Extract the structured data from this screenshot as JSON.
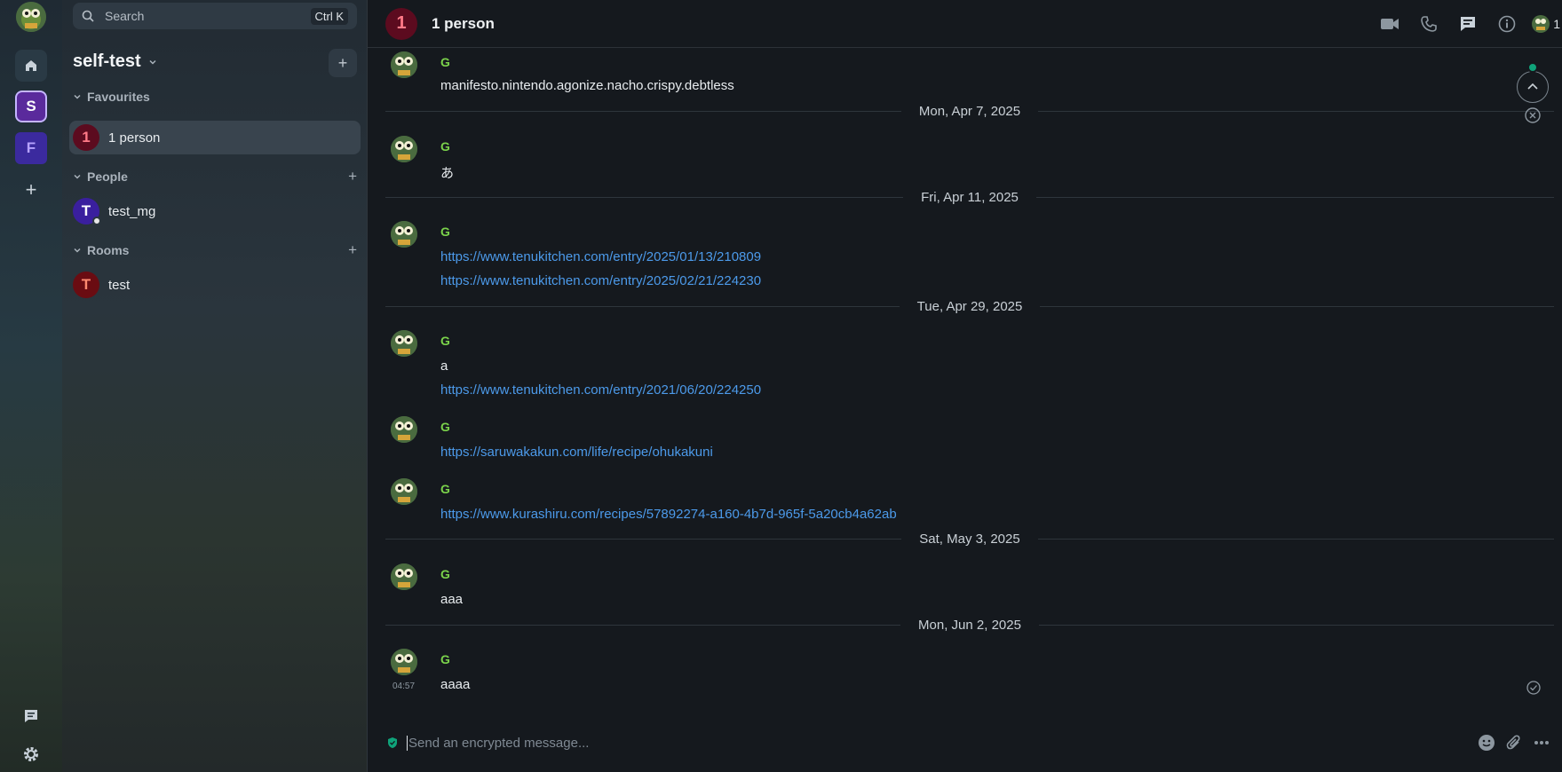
{
  "rail": {
    "spaces": [
      {
        "letter": "S",
        "name": "self-test"
      },
      {
        "letter": "F",
        "name": "F"
      }
    ],
    "add_symbol": "+"
  },
  "sidebar": {
    "search_placeholder": "Search",
    "search_shortcut": "Ctrl K",
    "space_name": "self-test",
    "add_symbol": "+",
    "sections": [
      {
        "label": "Favourites",
        "rooms": [
          {
            "initial": "1",
            "name": "1 person",
            "color": "#5c0b1f",
            "text_color": "#ff7a88",
            "active": true
          }
        ]
      },
      {
        "label": "People",
        "rooms": [
          {
            "initial": "T",
            "name": "test_mg",
            "color": "#3a1f9e",
            "text_color": "#ffffff",
            "active": false
          }
        ]
      },
      {
        "label": "Rooms",
        "rooms": [
          {
            "initial": "T",
            "name": "test",
            "color": "#6a0c12",
            "text_color": "#ff8a70",
            "active": false
          }
        ]
      }
    ]
  },
  "header": {
    "room_initial": "1",
    "room_name": "1 person",
    "member_count": "1",
    "icons": [
      "video-call-icon",
      "voice-call-icon",
      "threads-icon",
      "room-info-icon"
    ]
  },
  "timeline": {
    "first_message": {
      "sender": "G",
      "text": "manifesto.nintendo.agonize.nacho.crispy.debtless"
    },
    "groups": [
      {
        "date": "Mon, Apr 7, 2025",
        "messages": [
          {
            "sender": "G",
            "lines": [
              {
                "text": "あ",
                "link": false
              }
            ]
          }
        ]
      },
      {
        "date": "Fri, Apr 11, 2025",
        "messages": [
          {
            "sender": "G",
            "lines": [
              {
                "text": "https://www.tenukitchen.com/entry/2025/01/13/210809",
                "link": true
              },
              {
                "text": "https://www.tenukitchen.com/entry/2025/02/21/224230",
                "link": true
              }
            ]
          }
        ]
      },
      {
        "date": "Tue, Apr 29, 2025",
        "messages": [
          {
            "sender": "G",
            "lines": [
              {
                "text": "a",
                "link": false
              },
              {
                "text": "https://www.tenukitchen.com/entry/2021/06/20/224250",
                "link": true
              }
            ]
          },
          {
            "sender": "G",
            "lines": [
              {
                "text": "https://saruwakakun.com/life/recipe/ohukakuni",
                "link": true
              }
            ]
          },
          {
            "sender": "G",
            "lines": [
              {
                "text": "https://www.kurashiru.com/recipes/57892274-a160-4b7d-965f-5a20cb4a62ab",
                "link": true
              }
            ]
          }
        ]
      },
      {
        "date": "Sat, May 3, 2025",
        "messages": [
          {
            "sender": "G",
            "lines": [
              {
                "text": "aaa",
                "link": false
              }
            ]
          }
        ]
      },
      {
        "date": "Mon, Jun 2, 2025",
        "messages": [
          {
            "sender": "G",
            "timestamp": "04:57",
            "lines": [
              {
                "text": "aaaa",
                "link": false
              }
            ]
          }
        ]
      }
    ]
  },
  "composer": {
    "placeholder": "Send an encrypted message..."
  },
  "colors": {
    "sender": "#7bd34b",
    "link": "#4c9aea",
    "accent_green": "#0fa37a"
  }
}
